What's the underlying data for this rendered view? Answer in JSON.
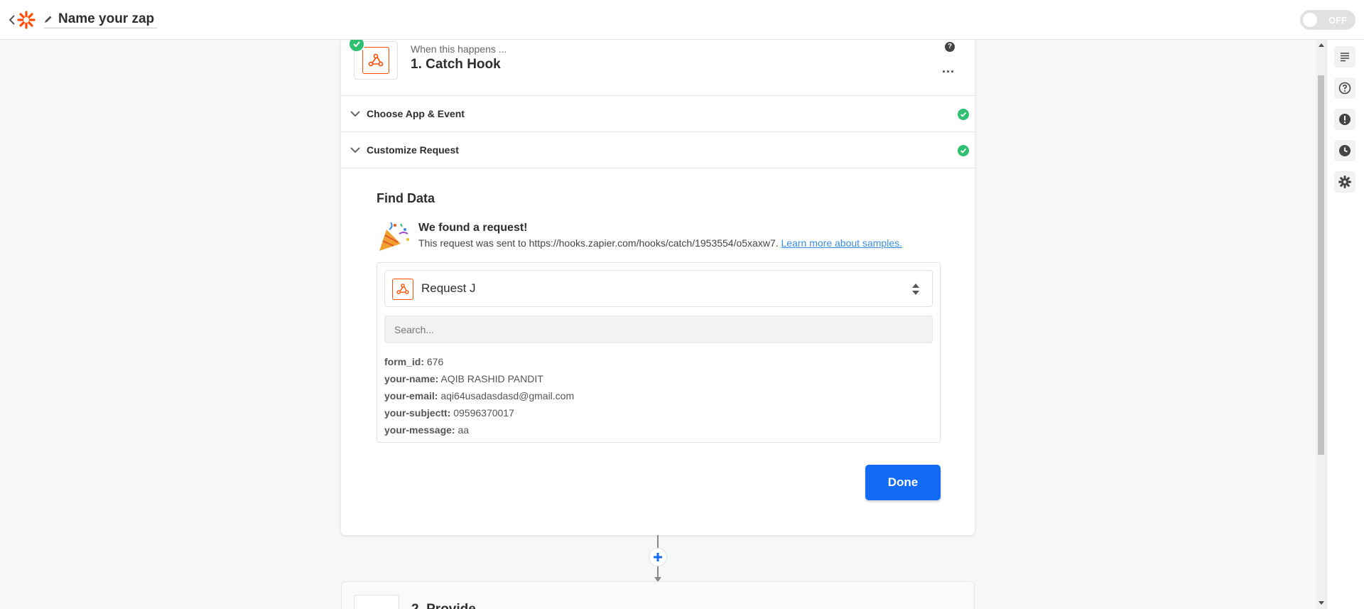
{
  "header": {
    "zap_name": "Name your zap",
    "toggle_label": "OFF"
  },
  "step": {
    "when_text": "When this happens ...",
    "title": "1. Catch Hook",
    "help": "?",
    "more": "..."
  },
  "sections": [
    {
      "label": "Choose App & Event"
    },
    {
      "label": "Customize Request"
    }
  ],
  "find_data": {
    "title": "Find Data",
    "found_title": "We found a request!",
    "found_desc": "This request was sent to https://hooks.zapier.com/hooks/catch/1953554/o5xaxw7.",
    "learn_more": "Learn more about samples.",
    "selected_request": "Request J",
    "search_placeholder": "Search...",
    "fields": [
      {
        "key": "form_id:",
        "value": "676"
      },
      {
        "key": "your-name:",
        "value": "AQIB RASHID PANDIT"
      },
      {
        "key": "your-email:",
        "value": "aqi64usadasdasd@gmail.com"
      },
      {
        "key": "your-subjectt:",
        "value": "09596370017"
      },
      {
        "key": "your-message:",
        "value": "aa"
      }
    ],
    "done_label": "Done"
  },
  "next_step": {
    "title": "2. Provide"
  },
  "colors": {
    "accent": "#136bf5",
    "brand": "#ff4a00",
    "success": "#2fbf71"
  }
}
